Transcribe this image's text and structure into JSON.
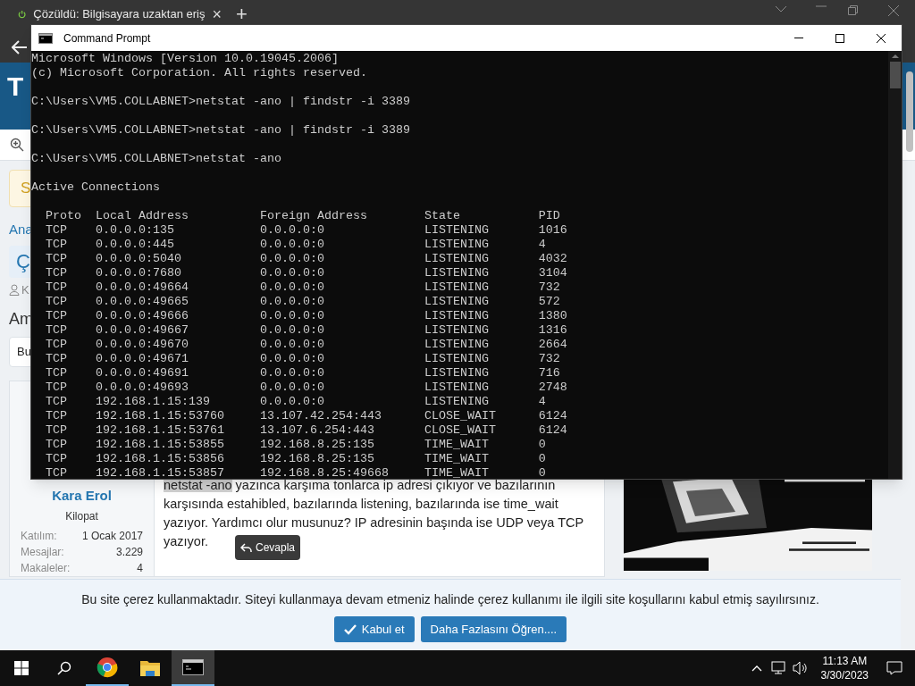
{
  "browser": {
    "tab": {
      "title": "Çözüldü: Bilgisayara uzaktan eriş",
      "close": "×"
    },
    "new_tab": "+"
  },
  "page": {
    "logo": "T",
    "left_fragments": [
      {
        "text": "S",
        "kind": "notice"
      },
      {
        "text": "Ana",
        "kind": "link"
      },
      {
        "text": "Ç",
        "kind": "title"
      },
      {
        "text": "K",
        "kind": "meta"
      },
      {
        "text": "Am",
        "kind": "heading"
      },
      {
        "text": "Bu",
        "kind": "select"
      }
    ],
    "post": {
      "author": "Kara Erol",
      "role": "Kilopat",
      "stats": [
        {
          "label": "Katılım:",
          "value": "1 Ocak 2017"
        },
        {
          "label": "Mesajlar:",
          "value": "3.229"
        },
        {
          "label": "Makaleler:",
          "value": "4"
        }
      ],
      "body": [
        {
          "text": "netstat -ano",
          "highlighted": true
        },
        {
          "text": " yazınca karşıma tonlarca ip adresi çıkıyor ve bazılarının karşısında estahibled, bazılarında listening, bazılarında ise time_wait yazıyor. Yardımcı olur musunuz? IP adresinin başında ise UDP veya TCP yazıyor.",
          "highlighted": false
        }
      ],
      "tooltip": "Cevapla"
    }
  },
  "cookie_banner": {
    "message": "Bu site çerez kullanmaktadır. Siteyi kullanmaya devam etmeniz halinde çerez kullanımı ile ilgili site koşullarını kabul etmiş sayılırsınız.",
    "buttons": [
      {
        "label": "Kabul et",
        "kind": "accept"
      },
      {
        "label": "Daha Fazlasını Öğren....",
        "kind": "more"
      }
    ]
  },
  "cmd_window": {
    "title": "Command Prompt",
    "blocks": [
      [
        "Microsoft Windows [Version 10.0.19045.2006]",
        "(c) Microsoft Corporation. All rights reserved."
      ],
      [
        "C:\\Users\\VM5.COLLABNET>netstat -ano | findstr -i 3389"
      ],
      [
        "C:\\Users\\VM5.COLLABNET>netstat -ano | findstr -i 3389"
      ],
      [
        "C:\\Users\\VM5.COLLABNET>netstat -ano"
      ],
      [
        "Active Connections"
      ],
      [
        "  Proto  Local Address          Foreign Address        State           PID",
        "  TCP    0.0.0.0:135            0.0.0.0:0              LISTENING       1016",
        "  TCP    0.0.0.0:445            0.0.0.0:0              LISTENING       4",
        "  TCP    0.0.0.0:5040           0.0.0.0:0              LISTENING       4032",
        "  TCP    0.0.0.0:7680           0.0.0.0:0              LISTENING       3104",
        "  TCP    0.0.0.0:49664          0.0.0.0:0              LISTENING       732",
        "  TCP    0.0.0.0:49665          0.0.0.0:0              LISTENING       572",
        "  TCP    0.0.0.0:49666          0.0.0.0:0              LISTENING       1380",
        "  TCP    0.0.0.0:49667          0.0.0.0:0              LISTENING       1316",
        "  TCP    0.0.0.0:49670          0.0.0.0:0              LISTENING       2664",
        "  TCP    0.0.0.0:49671          0.0.0.0:0              LISTENING       732",
        "  TCP    0.0.0.0:49691          0.0.0.0:0              LISTENING       716",
        "  TCP    0.0.0.0:49693          0.0.0.0:0              LISTENING       2748",
        "  TCP    192.168.1.15:139       0.0.0.0:0              LISTENING       4",
        "  TCP    192.168.1.15:53760     13.107.42.254:443      CLOSE_WAIT      6124",
        "  TCP    192.168.1.15:53761     13.107.6.254:443       CLOSE_WAIT      6124",
        "  TCP    192.168.1.15:53855     192.168.8.25:135       TIME_WAIT       0",
        "  TCP    192.168.1.15:53856     192.168.8.25:135       TIME_WAIT       0",
        "  TCP    192.168.1.15:53857     192.168.8.25:49668     TIME_WAIT       0"
      ]
    ]
  },
  "taskbar": {
    "apps": [
      {
        "kind": "chrome",
        "open": true,
        "active": false
      },
      {
        "kind": "folder",
        "open": false,
        "active": false
      },
      {
        "kind": "terminal",
        "open": true,
        "active": true
      }
    ],
    "time": "11:13 AM",
    "date": "3/30/2023"
  }
}
